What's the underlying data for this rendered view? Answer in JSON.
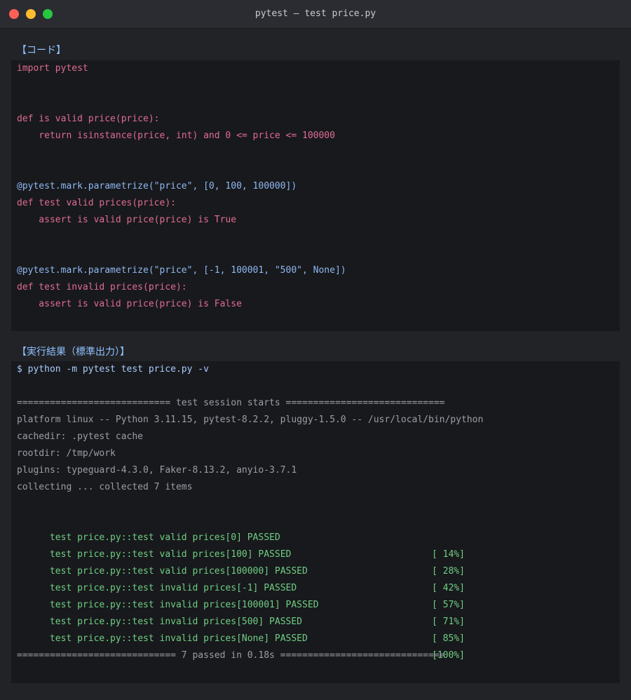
{
  "window": {
    "title": "pytest — test price.py",
    "controls": [
      "close",
      "minimize",
      "zoom"
    ]
  },
  "code_section": {
    "label": "【コード】",
    "lines": [
      {
        "text": "import pytest",
        "kind": "pink"
      },
      {
        "text": "def is valid price(price):",
        "kind": "pink"
      },
      {
        "text": "    return isinstance(price, int) and 0 <= price <= 100000",
        "kind": "pink"
      },
      {
        "text": "@pytest.mark.parametrize(\"price\", [0, 100, 100000])",
        "kind": "blue"
      },
      {
        "text": "def test valid prices(price):",
        "kind": "pink"
      },
      {
        "text": "    assert is valid price(price) is True",
        "kind": "pink"
      },
      {
        "text": "@pytest.mark.parametrize(\"price\", [-1, 100001, \"500\", None])",
        "kind": "blue"
      },
      {
        "text": "def test invalid prices(price):",
        "kind": "pink"
      },
      {
        "text": "    assert is valid price(price) is False",
        "kind": "pink"
      }
    ]
  },
  "output_section": {
    "label": "【実行結果（標準出力）】",
    "command": "$ python -m pytest test price.py -v",
    "header_lines": [
      "============================ test session starts =============================",
      "platform linux -- Python 3.11.15, pytest-8.2.2, pluggy-1.5.0 -- /usr/local/bin/python",
      "cachedir: .pytest cache",
      "rootdir: /tmp/work",
      "plugins: typeguard-4.3.0, Faker-8.13.2, anyio-3.7.1",
      "collecting ... collected 7 items"
    ],
    "results": [
      {
        "text": "test price.py::test valid prices[0] PASSED",
        "pct": "[ 14%]"
      },
      {
        "text": "test price.py::test valid prices[100] PASSED",
        "pct": "[ 28%]"
      },
      {
        "text": "test price.py::test valid prices[100000] PASSED",
        "pct": "[ 42%]"
      },
      {
        "text": "test price.py::test invalid prices[-1] PASSED",
        "pct": "[ 57%]"
      },
      {
        "text": "test price.py::test invalid prices[100001] PASSED",
        "pct": "[ 71%]"
      },
      {
        "text": "test price.py::test invalid prices[500] PASSED",
        "pct": "[ 85%]"
      },
      {
        "text": "test price.py::test invalid prices[None] PASSED",
        "pct": "[100%]"
      }
    ],
    "summary": "============================= 7 passed in 0.18s =============================="
  },
  "colors": {
    "code_keyword": "#e06c93",
    "decorator": "#8eb8f2",
    "output_text": "#9a9ea7",
    "passed": "#6fce84",
    "section_label": "#8ec1ff"
  }
}
